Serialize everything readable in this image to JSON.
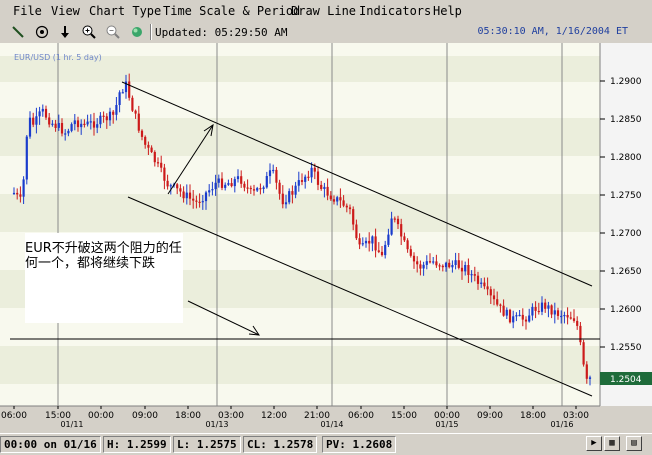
{
  "menu": [
    "File",
    "View",
    "Chart Type",
    "Time Scale & Period",
    "Draw Line",
    "Indicators",
    "Help"
  ],
  "toolbar": {
    "icons": [
      "draw-line-icon",
      "target-icon",
      "down-arrow-icon",
      "zoom-in-icon",
      "zoom-out-icon",
      "globe-icon"
    ],
    "updated_label": "Updated: 05:29:50 AM",
    "datetime": "05:30:10 AM, 1/16/2004 ET"
  },
  "chart": {
    "symbol_label": "EUR/USD (1 hr.  5 day)",
    "y_ticks": [
      "1.2900",
      "1.2850",
      "1.2800",
      "1.2750",
      "1.2700",
      "1.2650",
      "1.2600",
      "1.2550"
    ],
    "last_price": "1.2504",
    "x_time_labels": [
      "06:00",
      "15:00",
      "00:00",
      "09:00",
      "18:00",
      "03:00",
      "12:00",
      "21:00",
      "06:00",
      "15:00",
      "00:00",
      "09:00",
      "18:00",
      "03:00"
    ],
    "x_date_labels": [
      "01/11",
      "01/13",
      "01/14",
      "01/15",
      "01/16"
    ],
    "annotation_text": "EUR不升破这两个阻力的任何一个，都将继续下跌",
    "colors": {
      "up": "#1a3ccc",
      "down": "#cc1a1a",
      "line": "#000000",
      "band_light": "#f8f9ee",
      "band_dark": "#ebeedc",
      "price_tag": "#1e6b3a"
    }
  },
  "status": {
    "time": "00:00 on 01/16",
    "high": "H: 1.2599",
    "low": "L: 1.2575",
    "close": "CL: 1.2578",
    "pv": "PV: 1.2608"
  }
}
